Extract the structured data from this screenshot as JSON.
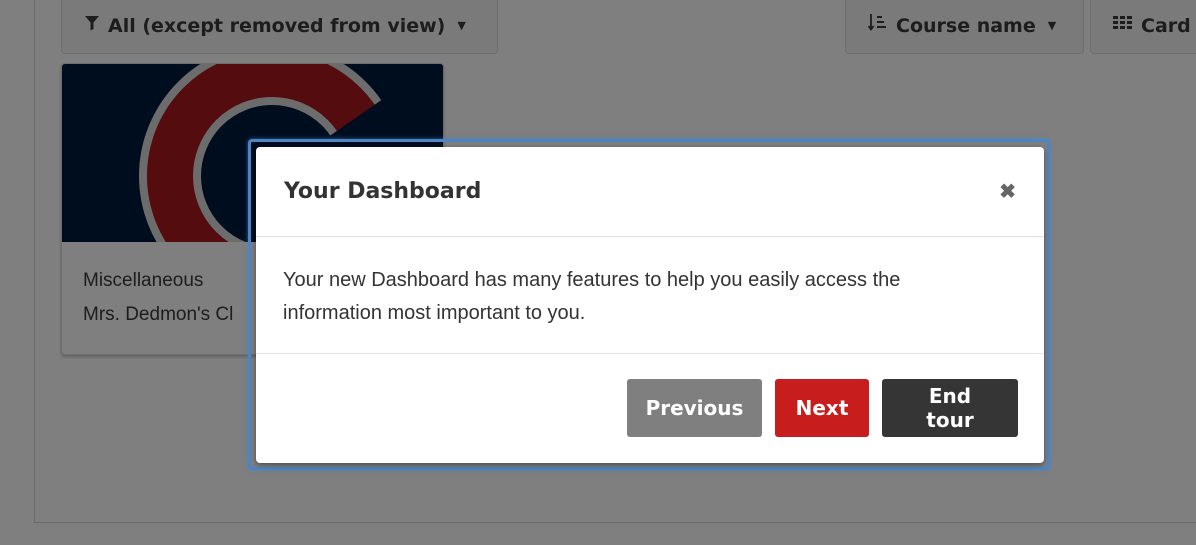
{
  "toolbar": {
    "filter_label": "All (except removed from view)",
    "sort_label": "Course name",
    "view_label": "Card"
  },
  "course": {
    "category": "Miscellaneous",
    "teacher": "Mrs. Dedmon's Cl"
  },
  "tour": {
    "title": "Your Dashboard",
    "close_glyph": "✖",
    "body_line1": "Your new Dashboard has many features to help you easily access the",
    "body_line2": "information most important to you.",
    "previous_label": "Previous",
    "next_label": "Next",
    "end_label": "End tour"
  },
  "icons": {
    "filter": "funnel-icon",
    "sort": "sort-icon",
    "view": "grid-icon",
    "caret": "caret-down-icon",
    "close": "close-icon"
  },
  "colors": {
    "next_button": "#c81d1d",
    "previous_button": "#7f7f7f",
    "end_button": "#353535",
    "highlight_border": "#4a86c6",
    "course_logo_navy": "#001b3e",
    "course_logo_red": "#a8191d"
  }
}
